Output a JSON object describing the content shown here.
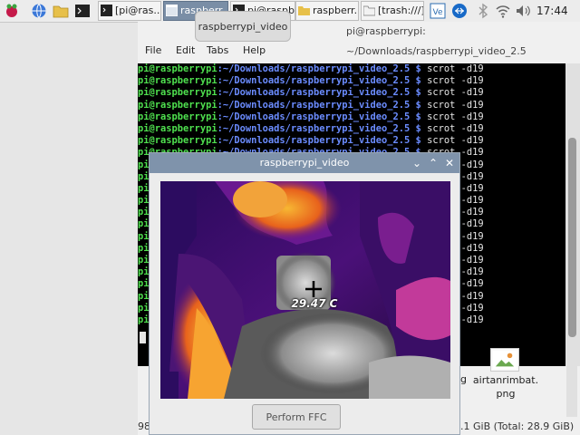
{
  "taskbar": {
    "buttons": [
      {
        "label": "[pi@ras..."
      },
      {
        "label": "raspberr..."
      },
      {
        "label": "pi@raspb..."
      },
      {
        "label": "raspberr..."
      },
      {
        "label": "[trash:///]"
      }
    ],
    "clock": "17:44"
  },
  "tooltip": "raspberrypi_video",
  "terminal": {
    "title": "pi@raspberrypi: ~/Downloads/raspberrypi_video_2.5",
    "menu": [
      "File",
      "Edit",
      "Tabs",
      "Help"
    ],
    "prompt_user": "pi@raspberrypi",
    "prompt_path": ":~/Downloads/raspberrypi_video_2.5 $",
    "command": " scrot -d19",
    "line_count": 22
  },
  "video_window": {
    "title": "raspberrypi_video",
    "temperature": "29.47 C",
    "ffc_label": "Perform FFC"
  },
  "file_manager": {
    "file_label": "airtanrimbat.png",
    "side_label": "g",
    "status_left": "98",
    "status_right": ".1 GiB (Total: 28.9 GiB)"
  },
  "colors": {
    "terminal_user": "#4fe04f",
    "terminal_path": "#6b8cff",
    "titlebar": "#7f93ab"
  }
}
